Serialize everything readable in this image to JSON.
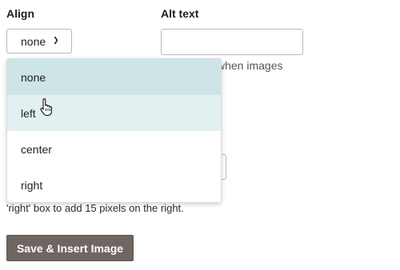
{
  "align": {
    "label": "Align",
    "selected": "none",
    "chevron_icon": "chevron-down-icon",
    "options": [
      "none",
      "left",
      "center",
      "right"
    ]
  },
  "alt_text": {
    "label": "Alt text",
    "value": "",
    "placeholder": "",
    "help_line1": "ws when images",
    "help_line2": "."
  },
  "margin": {
    "help_text": "'right' box to add 15 pixels on the right."
  },
  "actions": {
    "save_label": "Save & Insert Image"
  },
  "colors": {
    "button_bg": "#6f6662",
    "option_selected_bg": "#cde5e7",
    "option_hover_bg": "#e3f0f1"
  }
}
